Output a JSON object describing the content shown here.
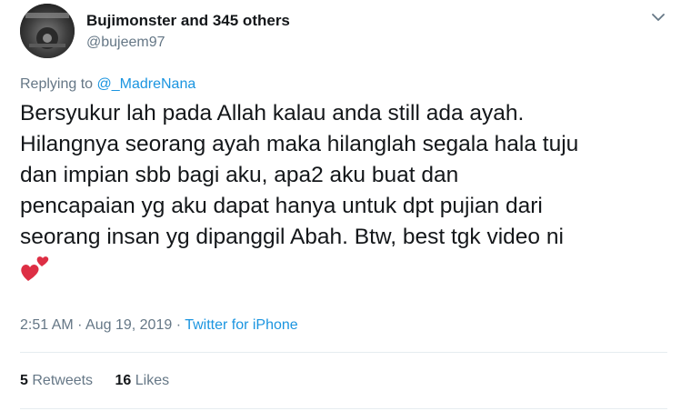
{
  "tweet": {
    "display_name": "Bujimonster and 345 others",
    "handle": "@bujeem97",
    "reply_prefix": "Replying to",
    "reply_target": "@_MadreNana",
    "text_lines": [
      "Bersyukur lah pada Allah kalau anda still ada ayah.",
      "Hilangnya seorang ayah maka hilanglah segala hala tuju",
      "dan impian sbb bagi aku, apa2 aku buat dan",
      "pencapaian yg aku dapat hanya untuk dpt pujian dari",
      "seorang insan yg dipanggil Abah. Btw, best tgk video ni"
    ],
    "emoji": "two-hearts-icon",
    "time": "2:51 AM",
    "date": "Aug 19, 2019",
    "separator": "·",
    "source": "Twitter for iPhone",
    "retweets_count": "5",
    "retweets_label": "Retweets",
    "likes_count": "16",
    "likes_label": "Likes"
  },
  "colors": {
    "text": "#14171a",
    "secondary": "#657786",
    "link": "#1b95e0",
    "divider": "#e6ecf0",
    "heart": "#e0245e"
  }
}
